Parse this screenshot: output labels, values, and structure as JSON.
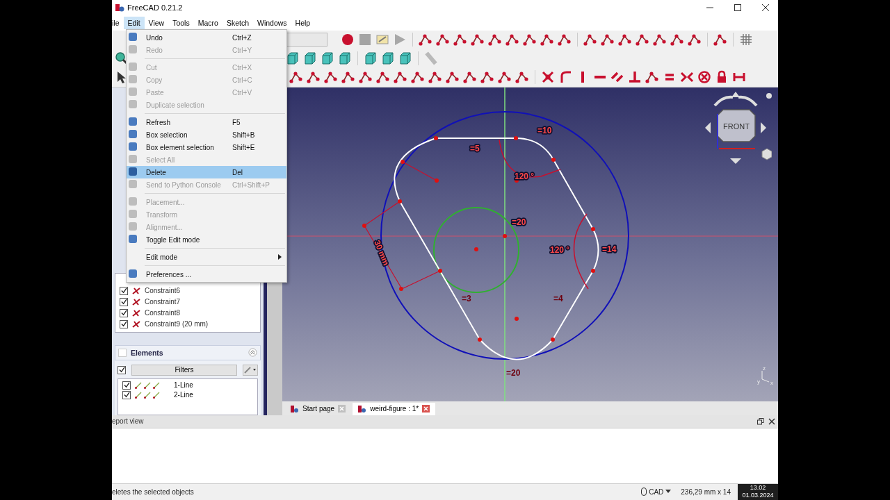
{
  "window": {
    "title": "FreeCAD 0.21.2"
  },
  "menu_bar": [
    {
      "label": "ile",
      "selected": false
    },
    {
      "label": "Edit",
      "selected": true
    },
    {
      "label": "View",
      "selected": false
    },
    {
      "label": "Tools",
      "selected": false
    },
    {
      "label": "Macro",
      "selected": false
    },
    {
      "label": "Sketch",
      "selected": false
    },
    {
      "label": "Windows",
      "selected": false
    },
    {
      "label": "Help",
      "selected": false
    }
  ],
  "edit_menu": [
    {
      "kind": "item",
      "label": "Undo",
      "shortcut": "Ctrl+Z",
      "disabled": false,
      "selected": false
    },
    {
      "kind": "item",
      "label": "Redo",
      "shortcut": "Ctrl+Y",
      "disabled": true,
      "selected": false
    },
    {
      "kind": "separator"
    },
    {
      "kind": "item",
      "label": "Cut",
      "shortcut": "Ctrl+X",
      "disabled": true,
      "selected": false
    },
    {
      "kind": "item",
      "label": "Copy",
      "shortcut": "Ctrl+C",
      "disabled": true,
      "selected": false
    },
    {
      "kind": "item",
      "label": "Paste",
      "shortcut": "Ctrl+V",
      "disabled": true,
      "selected": false
    },
    {
      "kind": "item",
      "label": "Duplicate selection",
      "disabled": true,
      "selected": false
    },
    {
      "kind": "separator"
    },
    {
      "kind": "item",
      "label": "Refresh",
      "shortcut": "F5",
      "disabled": false,
      "selected": false
    },
    {
      "kind": "item",
      "label": "Box selection",
      "shortcut": "Shift+B",
      "disabled": false,
      "selected": false
    },
    {
      "kind": "item",
      "label": "Box element selection",
      "shortcut": "Shift+E",
      "disabled": false,
      "selected": false
    },
    {
      "kind": "item",
      "label": "Select All",
      "disabled": true,
      "selected": false
    },
    {
      "kind": "item",
      "label": "Delete",
      "shortcut": "Del",
      "disabled": false,
      "selected": true
    },
    {
      "kind": "item",
      "label": "Send to Python Console",
      "shortcut": "Ctrl+Shift+P",
      "disabled": true,
      "selected": false
    },
    {
      "kind": "separator"
    },
    {
      "kind": "item",
      "label": "Placement...",
      "disabled": true,
      "selected": false
    },
    {
      "kind": "item",
      "label": "Transform",
      "disabled": true,
      "selected": false
    },
    {
      "kind": "item",
      "label": "Alignment...",
      "disabled": true,
      "selected": false
    },
    {
      "kind": "item",
      "label": "Toggle Edit mode",
      "disabled": false,
      "selected": false
    },
    {
      "kind": "separator"
    },
    {
      "kind": "submenu",
      "label": "Edit mode",
      "disabled": false,
      "selected": false
    },
    {
      "kind": "separator"
    },
    {
      "kind": "item",
      "label": "Preferences ...",
      "disabled": false,
      "selected": false
    }
  ],
  "constraints": [
    {
      "label": "Constraint6",
      "checked": true
    },
    {
      "label": "Constraint7",
      "checked": true
    },
    {
      "label": "Constraint8",
      "checked": true
    },
    {
      "label": "Constraint9 (20 mm)",
      "checked": true
    }
  ],
  "elements_panel": {
    "title": "Elements",
    "all_checked": true,
    "filter": "Filters",
    "items": [
      {
        "label": "1-Line",
        "checked": true
      },
      {
        "label": "2-Line",
        "checked": true
      }
    ]
  },
  "sketch": {
    "dimension_labels": [
      "=10",
      "=5",
      "120 °",
      "=20",
      "120 °",
      "=14",
      "=3",
      "=4",
      "=20",
      "30 mm"
    ],
    "view_cube": "FRONT",
    "axis_labels": [
      "z",
      "y",
      "x"
    ]
  },
  "document_tabs": [
    {
      "label": "Start page",
      "selected": false
    },
    {
      "label": "weird-figure : 1*",
      "selected": true
    }
  ],
  "report_view": {
    "title": "eport view"
  },
  "status_bar": {
    "message": "eletes the selected objects",
    "navigation": "CAD",
    "dimensions": "236,29 mm x 14",
    "time": "13.02",
    "date": "01.03.2024"
  }
}
